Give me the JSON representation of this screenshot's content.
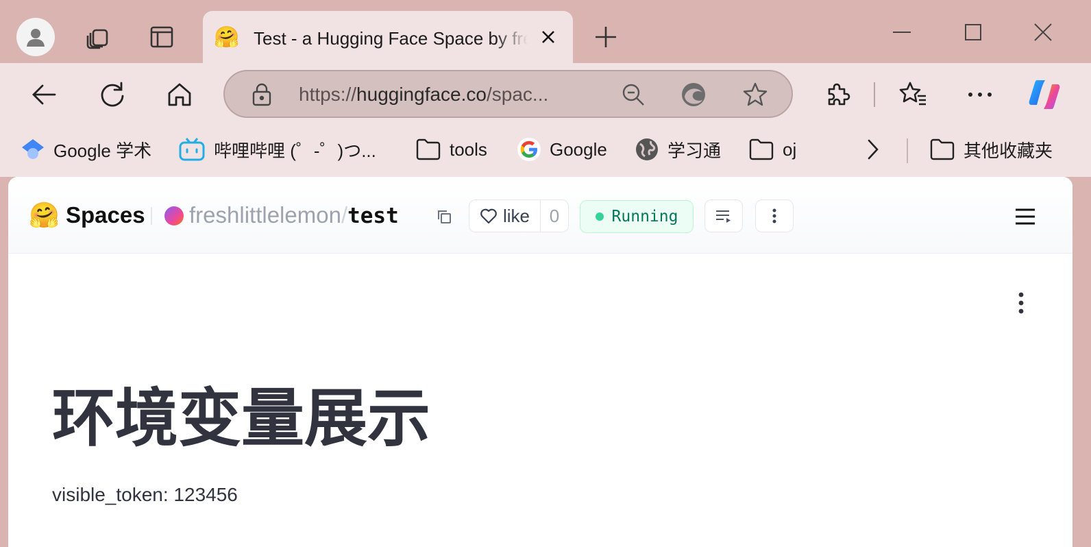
{
  "browser": {
    "tab": {
      "emoji": "🤗",
      "title": "Test - a Hugging Face Space by freshlittlelemon"
    },
    "address": {
      "scheme": "https://",
      "host": "huggingface.co",
      "path": "/spac..."
    },
    "bookmarks": [
      {
        "label": "Google 学术",
        "icon": "google-scholar-icon"
      },
      {
        "label": "哔哩哔哩 (゜-゜)つ...",
        "icon": "bilibili-icon"
      },
      {
        "label": "tools",
        "icon": "folder-icon"
      },
      {
        "label": "Google",
        "icon": "google-icon"
      },
      {
        "label": "学习通",
        "icon": "globe-icon"
      },
      {
        "label": "oj",
        "icon": "folder-icon"
      }
    ],
    "other_bookmarks": "其他收藏夹"
  },
  "hf": {
    "logo": "🤗",
    "spaces_label": "Spaces",
    "owner": "freshlittlelemon",
    "slash": "/",
    "repo": "test",
    "like_label": "like",
    "like_count": "0",
    "status": "Running",
    "status_color": "#34d399"
  },
  "app": {
    "title": "环境变量展示",
    "line": "visible_token: 123456"
  }
}
